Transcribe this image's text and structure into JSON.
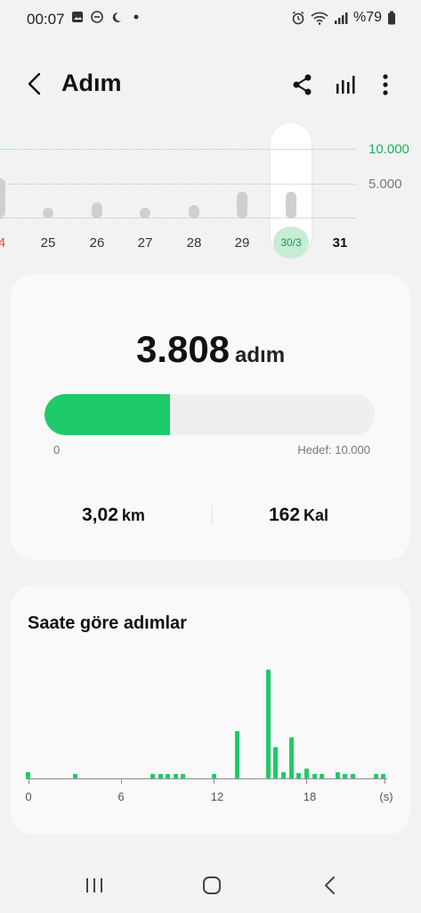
{
  "status_bar": {
    "time": "00:07",
    "left_icons": [
      "gallery-icon",
      "dnd-icon",
      "moon-icon",
      "dot-icon"
    ],
    "right_icons": [
      "alarm-icon",
      "wifi-icon",
      "signal-icon",
      "battery-icon"
    ],
    "battery": "%79"
  },
  "app_bar": {
    "title": "Adım",
    "actions": [
      "share-icon",
      "chart-icon",
      "more-icon"
    ]
  },
  "day_chart": {
    "grid_labels": [
      "10.000",
      "5.000"
    ],
    "days": [
      {
        "label": "4",
        "color": "#d94a43"
      },
      {
        "label": "25"
      },
      {
        "label": "26"
      },
      {
        "label": "27"
      },
      {
        "label": "28"
      },
      {
        "label": "29"
      },
      {
        "label": "30/3",
        "selected": true
      },
      {
        "label": "31"
      }
    ]
  },
  "summary": {
    "steps": "3.808",
    "steps_unit": "adım",
    "progress_fraction": 0.3808,
    "progress_min": "0",
    "goal": "Hedef: 10.000",
    "distance": "3,02",
    "distance_unit": "km",
    "calories": "162",
    "calories_unit": "Kal"
  },
  "hourly": {
    "title": "Saate göre adımlar",
    "x_labels": [
      "0",
      "6",
      "12",
      "18",
      "(s)"
    ]
  },
  "colors": {
    "accent": "#1fca6a",
    "background": "#f2f2f2",
    "card": "#f9f9f9"
  },
  "nav_bar": {
    "buttons": [
      "recents-icon",
      "home-icon",
      "back-icon"
    ]
  }
}
